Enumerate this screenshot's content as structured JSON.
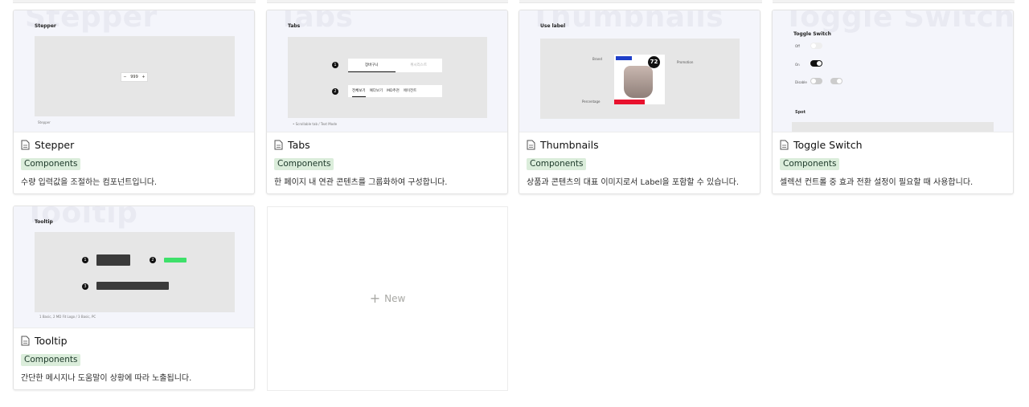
{
  "cards": [
    {
      "title": "Stepper",
      "tag": "Components",
      "description": "수량 입력값을 조절하는 컴포넌트입니다.",
      "cover": {
        "ghost": "Stepper",
        "heading": "Stepper",
        "value": "999",
        "footer": "Stepper"
      }
    },
    {
      "title": "Tabs",
      "tag": "Components",
      "description": "한 페이지 내 연관 콘텐츠를 그룹화하여 구성합니다.",
      "cover": {
        "ghost": "Tabs",
        "heading": "Tabs",
        "tabs_row1": [
          "장바구니",
          "위시리스트"
        ],
        "tabs_row2": [
          "전체보기",
          "예다보기",
          "MD추천",
          "에이전트"
        ],
        "footer": "• Scrollable tab / Text Mode"
      }
    },
    {
      "title": "Thumbnails",
      "tag": "Components",
      "description": "상품과 콘텐츠의 대표 이미지로서 Label을 포함할 수 있습니다.",
      "cover": {
        "ghost": "Thumbnails",
        "heading": "Use label",
        "label_left": "Brand",
        "label_right": "Promotion",
        "label_bottom": "Percentage",
        "badge": "72"
      }
    },
    {
      "title": "Toggle Switch",
      "tag": "Components",
      "description": "셀렉션 컨트롤 중 효과 전환 설정이 필요할 때 사용합니다.",
      "cover": {
        "ghost": "Toggle Switch",
        "heading": "Toggle Switch",
        "off": "Off",
        "on": "On",
        "disable": "Disable",
        "spot": "Spot"
      }
    },
    {
      "title": "Tooltip",
      "tag": "Components",
      "description": "간단한 메시지나 도움말이 상황에 따라 노출됩니다.",
      "cover": {
        "ghost": "Tooltip",
        "heading": "Tooltip",
        "footer": "1 Basic, 2 MD Fit Logo / 3 Basic, PC"
      }
    }
  ],
  "new_button": {
    "icon": "plus-icon",
    "label": "New"
  }
}
